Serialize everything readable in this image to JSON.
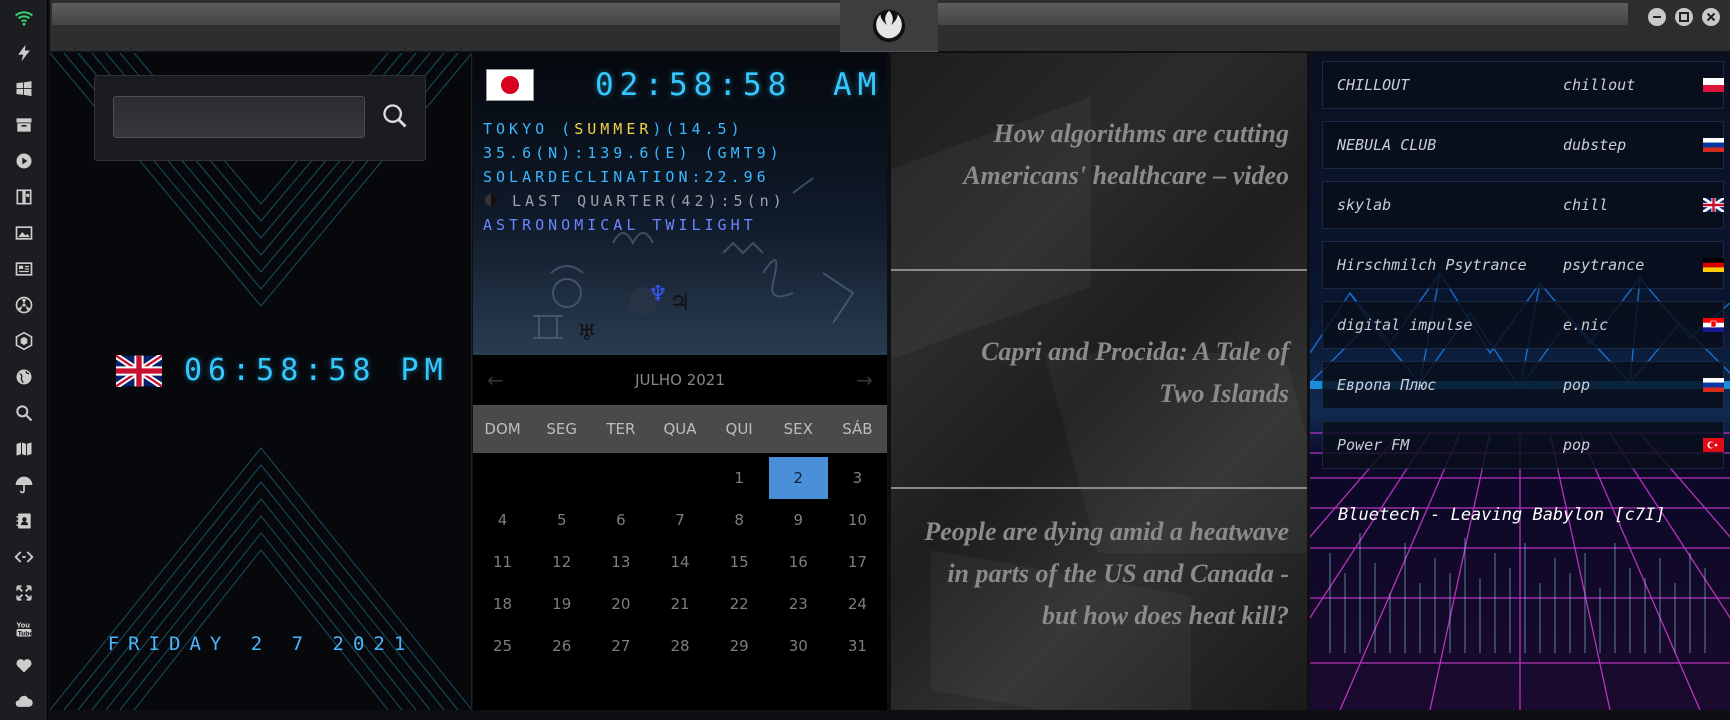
{
  "sidebar": {
    "icons": [
      "wifi-icon",
      "lightning-icon",
      "windows-icon",
      "archive-icon",
      "play-icon",
      "map-book-icon",
      "image-icon",
      "news-icon",
      "radiation-icon",
      "hexagon-icon",
      "globe-icon",
      "search-icon",
      "map-icon",
      "umbrella-icon",
      "contacts-icon",
      "code-icon",
      "fullscreen-icon",
      "youtube-icon",
      "heart-icon",
      "cloud-icon"
    ]
  },
  "colors": {
    "accent_cyan": "#35c8ff",
    "highlight_yellow": "#f0d24a",
    "today_blue": "#4a90d9",
    "wifi_green": "#3bd16f"
  },
  "search": {
    "value": "",
    "placeholder": ""
  },
  "uk_clock": {
    "time": "06:58:58 PM",
    "date": "FRIDAY 2 7 2021"
  },
  "jp_clock": {
    "time": "02:58:58",
    "ampm": "AM",
    "city": "TOKYO (",
    "season": "SUMMER",
    "city_rest": ")(14.5)",
    "coords": "35.6(N):139.6(E) (GMT9)",
    "solar": "SOLARDECLINATION:22.96",
    "moon": "LAST QUARTER(42):5(n)",
    "twilight": "ASTRONOMICAL TWILIGHT"
  },
  "calendar": {
    "month_label": "JULHO 2021",
    "prev": "←",
    "next": "→",
    "weekdays": [
      "DOM",
      "SEG",
      "TER",
      "QUA",
      "QUI",
      "SEX",
      "SÁB"
    ],
    "today": "2",
    "cells": [
      "",
      "",
      "",
      "",
      "1",
      "2",
      "3",
      "4",
      "5",
      "6",
      "7",
      "8",
      "9",
      "10",
      "11",
      "12",
      "13",
      "14",
      "15",
      "16",
      "17",
      "18",
      "19",
      "20",
      "21",
      "22",
      "23",
      "24",
      "25",
      "26",
      "27",
      "28",
      "29",
      "30",
      "31"
    ]
  },
  "news": [
    {
      "title": "How algorithms are cutting Americans' healthcare – video"
    },
    {
      "title": "Capri and Procida: A Tale of Two Islands"
    },
    {
      "title": "People are dying amid a heatwave in parts of the US and Canada - but how does heat kill?"
    }
  ],
  "radio": {
    "stations": [
      {
        "name": "CHILLOUT",
        "genre": "chillout",
        "flag": "pl"
      },
      {
        "name": "NEBULA CLUB",
        "genre": "dubstep",
        "flag": "ru"
      },
      {
        "name": "skylab",
        "genre": "chill",
        "flag": "uk"
      },
      {
        "name": "Hirschmilch Psytrance",
        "genre": "psytrance",
        "flag": "de"
      },
      {
        "name": "digital impulse",
        "genre": "e.nic",
        "flag": "hr"
      },
      {
        "name": "Европа Плюс",
        "genre": "pop",
        "flag": "ru"
      },
      {
        "name": "Power FM",
        "genre": "pop",
        "flag": "tr"
      }
    ],
    "now_playing": "Bluetech - Leaving Babylon [c7I]"
  }
}
